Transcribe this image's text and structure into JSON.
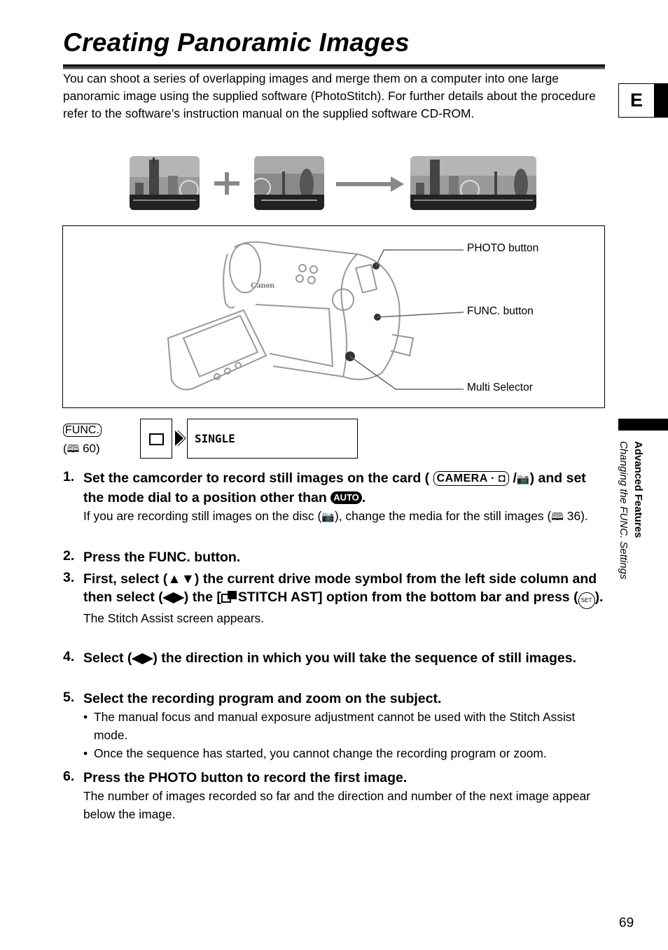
{
  "header": {
    "title": "Creating Panoramic Images",
    "language_tab": "E"
  },
  "intro": "You can shoot a series of overlapping images and merge them on a computer into one large panoramic image using the supplied software (PhotoStitch). For further details about the procedure refer to the software’s instruction manual on the supplied software CD-ROM.",
  "illustration": {
    "operators": [
      "plus-icon",
      "arrow-right-icon"
    ]
  },
  "diagram": {
    "callouts": [
      "PHOTO button",
      "FUNC. button",
      "Multi Selector"
    ],
    "brand": "Canon"
  },
  "func_ref": {
    "badge": "FUNC.",
    "page_ref": "60"
  },
  "menu": {
    "current": "SINGLE"
  },
  "steps": [
    {
      "num": "1.",
      "head_a": "Set the camcorder to record still images on the card (",
      "pill": "CAMERA · ◘",
      "head_b": "/",
      "head_c": ") and set the mode dial to a position other than",
      "auto": "AUTO",
      "head_d": ".",
      "sub_a": "If you are recording still images on the disc (",
      "sub_b": "), change the media for the still images (",
      "sub_ref": "36",
      "sub_c": ")."
    },
    {
      "num": "2.",
      "head": "Press the FUNC. button."
    },
    {
      "num": "3.",
      "head_a": "First, select (",
      "updown": "▲▼",
      "head_b": ") the current drive mode symbol from the left side column and then select (",
      "leftright": "◀▶",
      "head_c": ") the [",
      "head_d": "STITCH AST] option from the bottom bar and press (",
      "set": "SET",
      "head_e": ").",
      "sub": "The Stitch Assist screen appears."
    },
    {
      "num": "4.",
      "head_a": "Select (",
      "leftright": "◀▶",
      "head_b": ") the direction in which you will take the sequence of still images."
    },
    {
      "num": "5.",
      "head": "Select the recording program and zoom on the subject.",
      "bullets": [
        "The manual focus and manual exposure adjustment cannot be used with the Stitch Assist mode.",
        "Once the sequence has started, you cannot change the recording program or zoom."
      ]
    },
    {
      "num": "6.",
      "head": "Press the PHOTO button to record the first image.",
      "sub": "The number of images recorded so far and the direction and number of the next image appear below the image."
    }
  ],
  "sidebar": {
    "section": "Advanced Features",
    "subsection": "Changing the FUNC. Settings"
  },
  "page_number": "69"
}
